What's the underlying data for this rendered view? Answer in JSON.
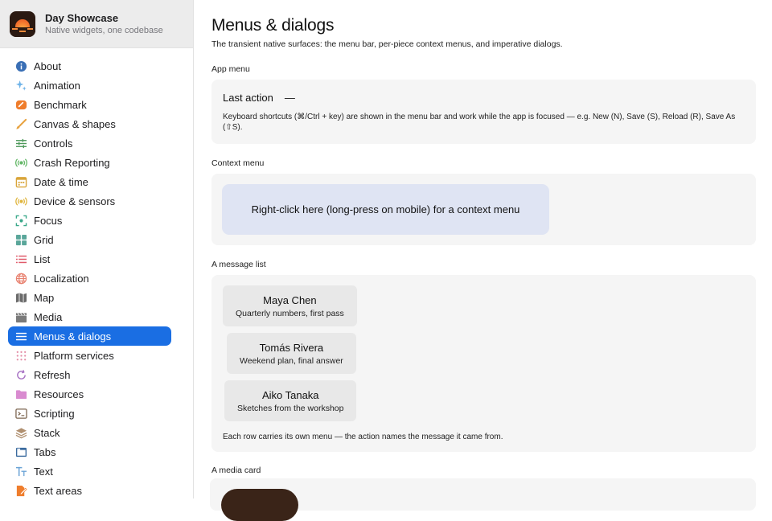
{
  "app": {
    "title": "Day Showcase",
    "subtitle": "Native widgets, one codebase"
  },
  "sidebar": {
    "items": [
      {
        "label": "About",
        "icon": "info-circle-icon",
        "color": "#3a6fb5",
        "active": false
      },
      {
        "label": "Animation",
        "icon": "sparkle-icon",
        "color": "#6fb3e8",
        "active": false
      },
      {
        "label": "Benchmark",
        "icon": "gauge-icon",
        "color": "#ef7d2c",
        "active": false
      },
      {
        "label": "Canvas & shapes",
        "icon": "brush-icon",
        "color": "#e8a341",
        "active": false
      },
      {
        "label": "Controls",
        "icon": "sliders-icon",
        "color": "#4f9a5c",
        "active": false
      },
      {
        "label": "Crash Reporting",
        "icon": "broadcast-icon",
        "color": "#66b86a",
        "active": false
      },
      {
        "label": "Date & time",
        "icon": "calendar-icon",
        "color": "#d9a53a",
        "active": false
      },
      {
        "label": "Device & sensors",
        "icon": "sensor-icon",
        "color": "#e0b640",
        "active": false
      },
      {
        "label": "Focus",
        "icon": "focus-icon",
        "color": "#3aa88a",
        "active": false
      },
      {
        "label": "Grid",
        "icon": "grid-icon",
        "color": "#5aa69a",
        "active": false
      },
      {
        "label": "List",
        "icon": "list-icon",
        "color": "#e05a6a",
        "active": false
      },
      {
        "label": "Localization",
        "icon": "globe-icon",
        "color": "#e8806e",
        "active": false
      },
      {
        "label": "Map",
        "icon": "map-icon",
        "color": "#6b6b6b",
        "active": false
      },
      {
        "label": "Media",
        "icon": "clapperboard-icon",
        "color": "#7a7a7a",
        "active": false
      },
      {
        "label": "Menus & dialogs",
        "icon": "menu-lines-icon",
        "color": "#ffffff",
        "active": true
      },
      {
        "label": "Platform services",
        "icon": "dots-grid-icon",
        "color": "#e48fa8",
        "active": false
      },
      {
        "label": "Refresh",
        "icon": "refresh-icon",
        "color": "#a873c4",
        "active": false
      },
      {
        "label": "Resources",
        "icon": "folder-icon",
        "color": "#d98bd0",
        "active": false
      },
      {
        "label": "Scripting",
        "icon": "terminal-icon",
        "color": "#7d6651",
        "active": false
      },
      {
        "label": "Stack",
        "icon": "stack-icon",
        "color": "#b09070",
        "active": false
      },
      {
        "label": "Tabs",
        "icon": "tabs-icon",
        "color": "#3a6a9e",
        "active": false
      },
      {
        "label": "Text",
        "icon": "text-icon",
        "color": "#6aa3d6",
        "active": false
      },
      {
        "label": "Text areas",
        "icon": "document-edit-icon",
        "color": "#ef7d2c",
        "active": false
      }
    ]
  },
  "main": {
    "title": "Menus & dialogs",
    "description": "The transient native surfaces: the menu bar, per-piece context menus, and imperative dialogs.",
    "app_menu": {
      "label": "App menu",
      "last_action_label": "Last action",
      "last_action_value": "—",
      "note": "Keyboard shortcuts (⌘/Ctrl + key) are shown in the menu bar and work while the app is focused — e.g. New (N), Save (S), Reload (R), Save As (⇧S)."
    },
    "context_menu": {
      "label": "Context menu",
      "target_text": "Right-click here (long-press on mobile) for a context menu"
    },
    "message_list": {
      "label": "A message list",
      "messages": [
        {
          "name": "Maya Chen",
          "preview": "Quarterly numbers, first pass"
        },
        {
          "name": "Tomás Rivera",
          "preview": "Weekend plan, final answer"
        },
        {
          "name": "Aiko Tanaka",
          "preview": "Sketches from the workshop"
        }
      ],
      "note": "Each row carries its own menu — the action names the message it came from."
    },
    "media_card": {
      "label": "A media card"
    }
  },
  "colors": {
    "accent": "#1a6ee3",
    "card_bg": "#f5f5f5",
    "context_bg": "#dfe4f3"
  }
}
